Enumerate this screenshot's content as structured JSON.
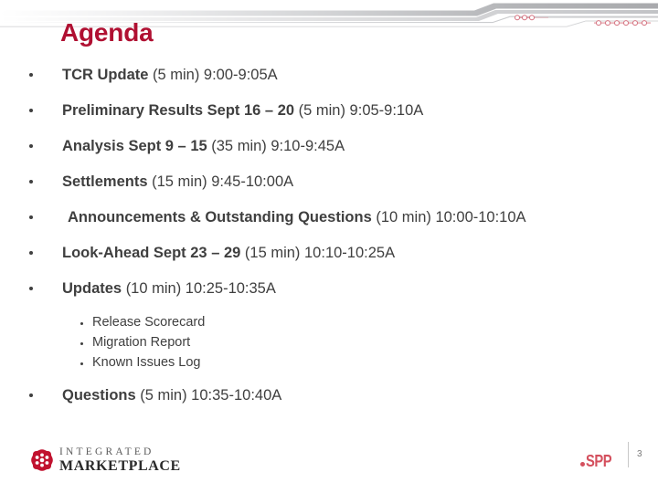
{
  "slide": {
    "title": "Agenda",
    "title_color": "#B01032",
    "body_color": "#3F3F3F",
    "background": "#ffffff"
  },
  "header": {
    "decoration_name": "circuit-trace-band",
    "band_gradient_from": "#ffffff",
    "band_gradient_to": "#A9AAAD",
    "trace_color": "#C9CACC",
    "node_color": "#D4707E",
    "node_group_left_count": 3,
    "node_group_right_count": 6
  },
  "agenda": {
    "items": [
      {
        "lead": "TCR Update ",
        "trail": "(5 min) 9:00-9:05A",
        "indented": false
      },
      {
        "lead": "Preliminary Results Sept 16 – 20 ",
        "trail": "(5 min) 9:05-9:10A",
        "indented": false
      },
      {
        "lead": "Analysis Sept 9 – 15 ",
        "trail": "(35 min) 9:10-9:45A",
        "indented": false
      },
      {
        "lead": "Settlements ",
        "trail": "(15 min) 9:45-10:00A",
        "indented": false
      },
      {
        "lead": "Announcements & Outstanding Questions ",
        "trail": "(10 min) 10:00-10:10A",
        "indented": true
      },
      {
        "lead": "Look-Ahead Sept 23 – 29 ",
        "trail": "(15 min) 10:10-10:25A",
        "indented": false
      },
      {
        "lead": "Updates ",
        "trail": "(10 min) 10:25-10:35A",
        "indented": false
      }
    ],
    "sub_items": [
      {
        "label": "Release Scorecard"
      },
      {
        "label": "Migration Report"
      },
      {
        "label": "Known Issues Log"
      }
    ],
    "final_item": {
      "lead": "Questions ",
      "trail": "(5 min) 10:35-10:40A",
      "indented": false
    }
  },
  "footer": {
    "integrated_marketplace": {
      "line1": "INTEGRATED",
      "line2": "MARKETPLACE",
      "emblem_color": "#C1122F"
    },
    "spp": {
      "word": "SPP",
      "color": "#D4505E"
    },
    "page_number": "3"
  }
}
